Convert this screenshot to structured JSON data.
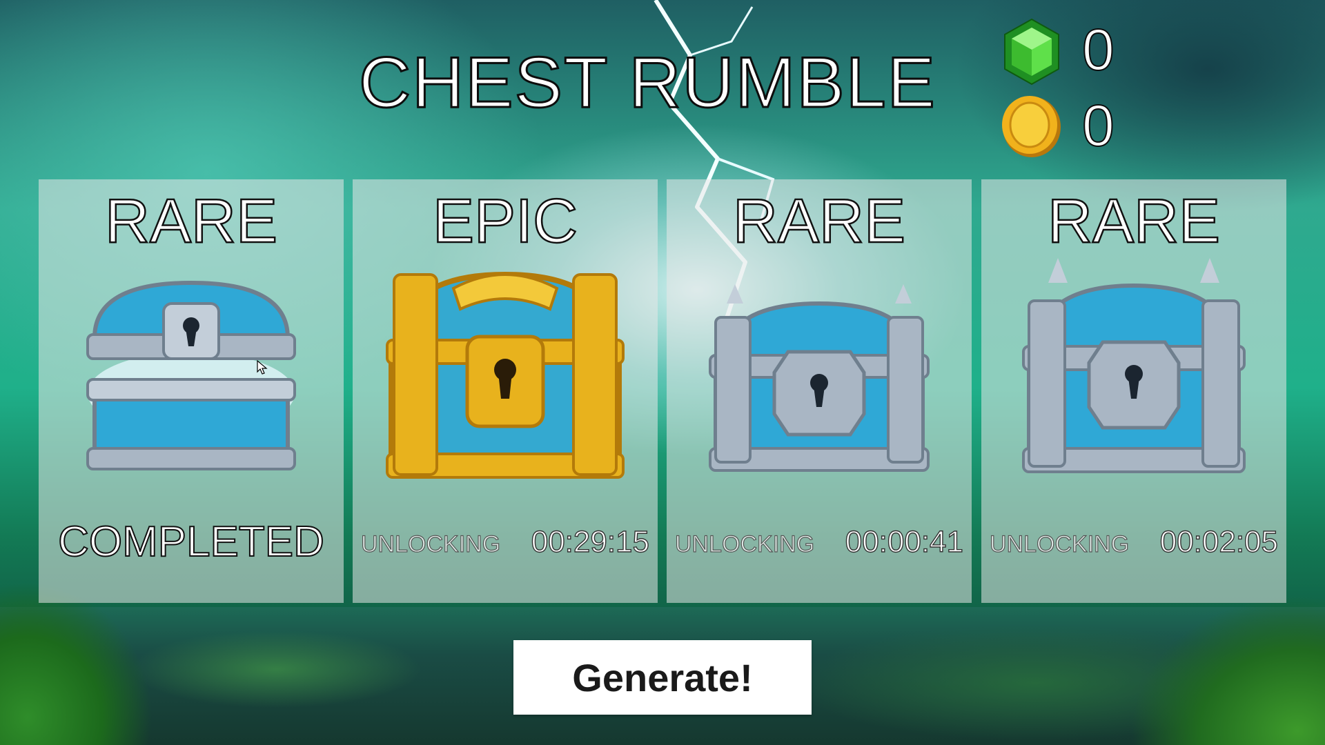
{
  "title": "CHEST RUMBLE",
  "currency": {
    "gems": {
      "icon": "green-gem-icon",
      "value": "0",
      "color": "#3fd23a"
    },
    "coins": {
      "icon": "gold-coin-icon",
      "value": "0",
      "color": "#f1b21c"
    }
  },
  "chest_slots": [
    {
      "rarity": "RARE",
      "chest_icon": "rare-chest-open-icon",
      "status": "COMPLETED",
      "timer": ""
    },
    {
      "rarity": "EPIC",
      "chest_icon": "epic-chest-icon",
      "status": "UNLOCKING",
      "timer": "00:29:15"
    },
    {
      "rarity": "RARE",
      "chest_icon": "rare-chest-icon",
      "status": "UNLOCKING",
      "timer": "00:00:41"
    },
    {
      "rarity": "RARE",
      "chest_icon": "rare-chest-icon",
      "status": "UNLOCKING",
      "timer": "00:02:05"
    }
  ],
  "generate_button": {
    "label": "Generate!"
  },
  "colors": {
    "rare_metal": "#a9b6c4",
    "rare_body": "#2fa8d6",
    "epic_gold": "#e8b21d",
    "slot_panel": "#e8e8e8"
  }
}
